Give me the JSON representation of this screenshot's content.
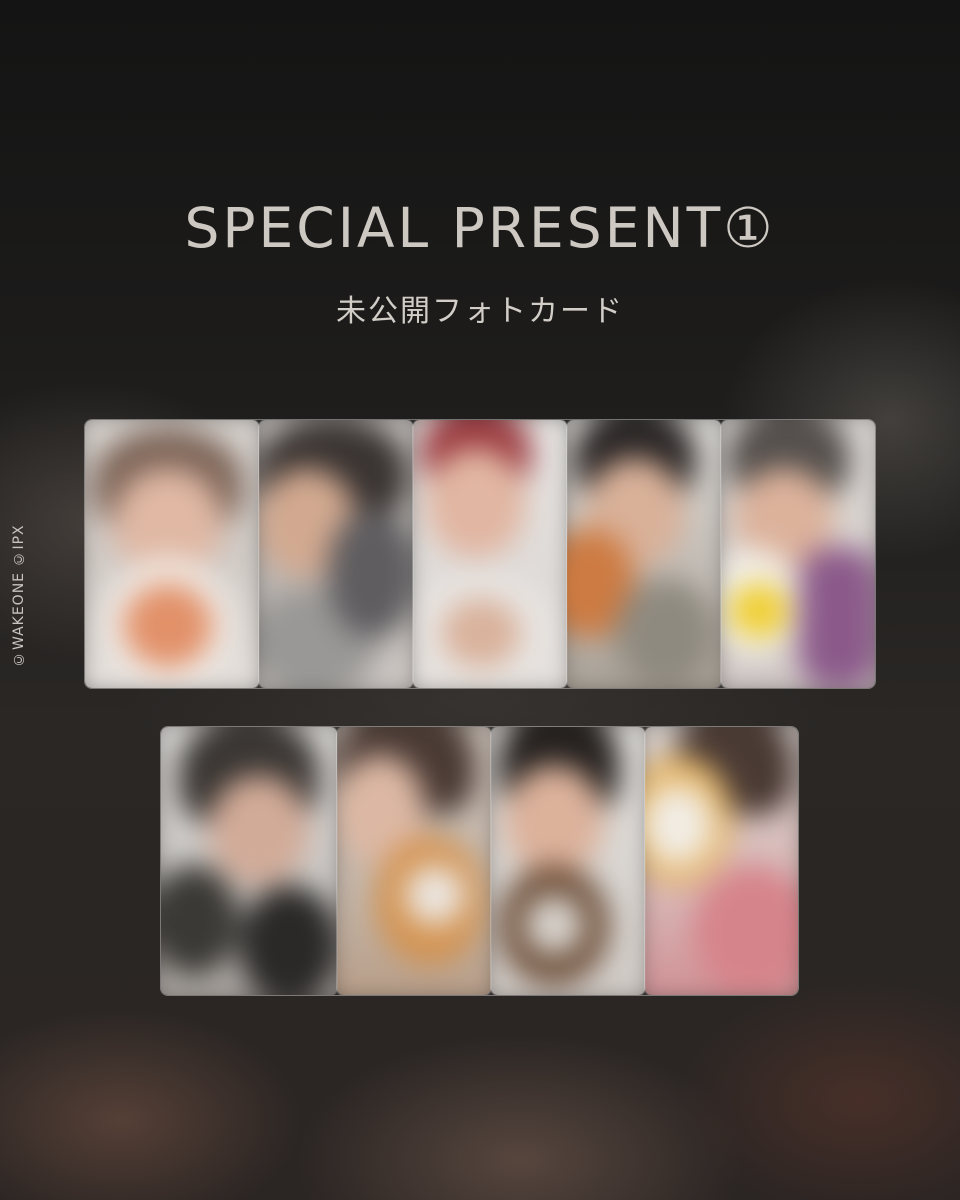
{
  "header": {
    "title": "SPECIAL PRESENT①",
    "subtitle": "未公開フォトカード"
  },
  "copyright": "©WAKEONE ©IPX",
  "photocards": {
    "row1": [
      {
        "name": "card-1"
      },
      {
        "name": "card-2"
      },
      {
        "name": "card-3"
      },
      {
        "name": "card-4"
      },
      {
        "name": "card-5"
      }
    ],
    "row2": [
      {
        "name": "card-6"
      },
      {
        "name": "card-7"
      },
      {
        "name": "card-8"
      },
      {
        "name": "card-9"
      }
    ]
  }
}
